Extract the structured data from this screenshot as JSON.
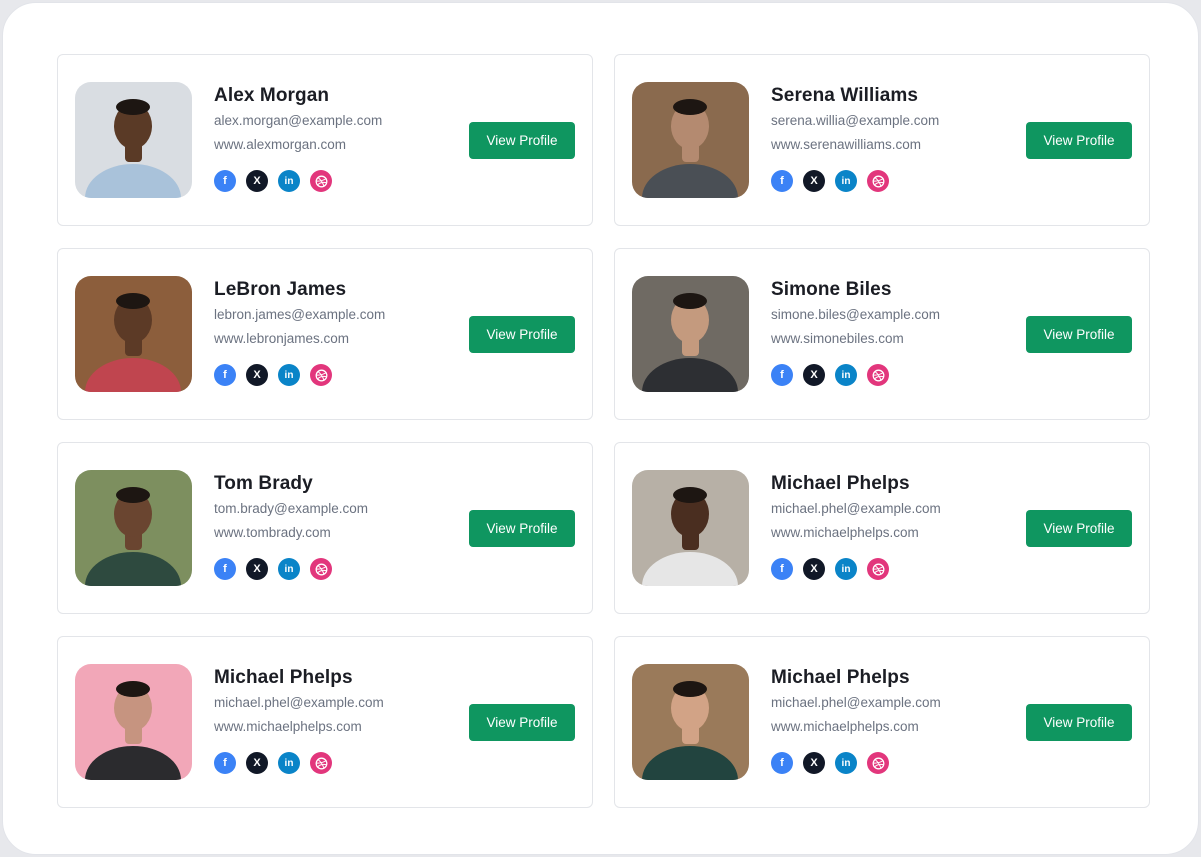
{
  "button_label": "View Profile",
  "colors": {
    "button": "#0f9660",
    "facebook": "#3b82f6",
    "x": "#111827",
    "linkedin": "#0a84c8",
    "dribbble": "#e2367c"
  },
  "social_icons": [
    "facebook-icon",
    "x-icon",
    "linkedin-icon",
    "dribbble-icon"
  ],
  "cards": [
    {
      "name": "Alex Morgan",
      "email": "alex.morgan@example.com",
      "website": "www.alexmorgan.com",
      "photo_bg": "#d9dde2",
      "skin": "#5a3a26",
      "shirt": "#a9c2da"
    },
    {
      "name": "Serena Williams",
      "email": "serena.willia@example.com",
      "website": "www.serenawilliams.com",
      "photo_bg": "#8a6a4e",
      "skin": "#b48a70",
      "shirt": "#4a4f55"
    },
    {
      "name": "LeBron James",
      "email": "lebron.james@example.com",
      "website": "www.lebronjames.com",
      "photo_bg": "#8c5e3c",
      "skin": "#5c3a26",
      "shirt": "#c0454f"
    },
    {
      "name": "Simone Biles",
      "email": "simone.biles@example.com",
      "website": "www.simonebiles.com",
      "photo_bg": "#6f6a63",
      "skin": "#c49a7e",
      "shirt": "#2d2f33"
    },
    {
      "name": "Tom Brady",
      "email": "tom.brady@example.com",
      "website": "www.tombrady.com",
      "photo_bg": "#7d8f5f",
      "skin": "#6a4530",
      "shirt": "#2e4a3f"
    },
    {
      "name": "Michael Phelps",
      "email": "michael.phel@example.com",
      "website": "www.michaelphelps.com",
      "photo_bg": "#b7b0a6",
      "skin": "#4a2e20",
      "shirt": "#e6e6e6"
    },
    {
      "name": "Michael Phelps",
      "email": "michael.phel@example.com",
      "website": "www.michaelphelps.com",
      "photo_bg": "#f2a7b8",
      "skin": "#c69480",
      "shirt": "#2b2b2e"
    },
    {
      "name": "Michael Phelps",
      "email": "michael.phel@example.com",
      "website": "www.michaelphelps.com",
      "photo_bg": "#9a7a5a",
      "skin": "#d2a386",
      "shirt": "#22443f"
    }
  ]
}
